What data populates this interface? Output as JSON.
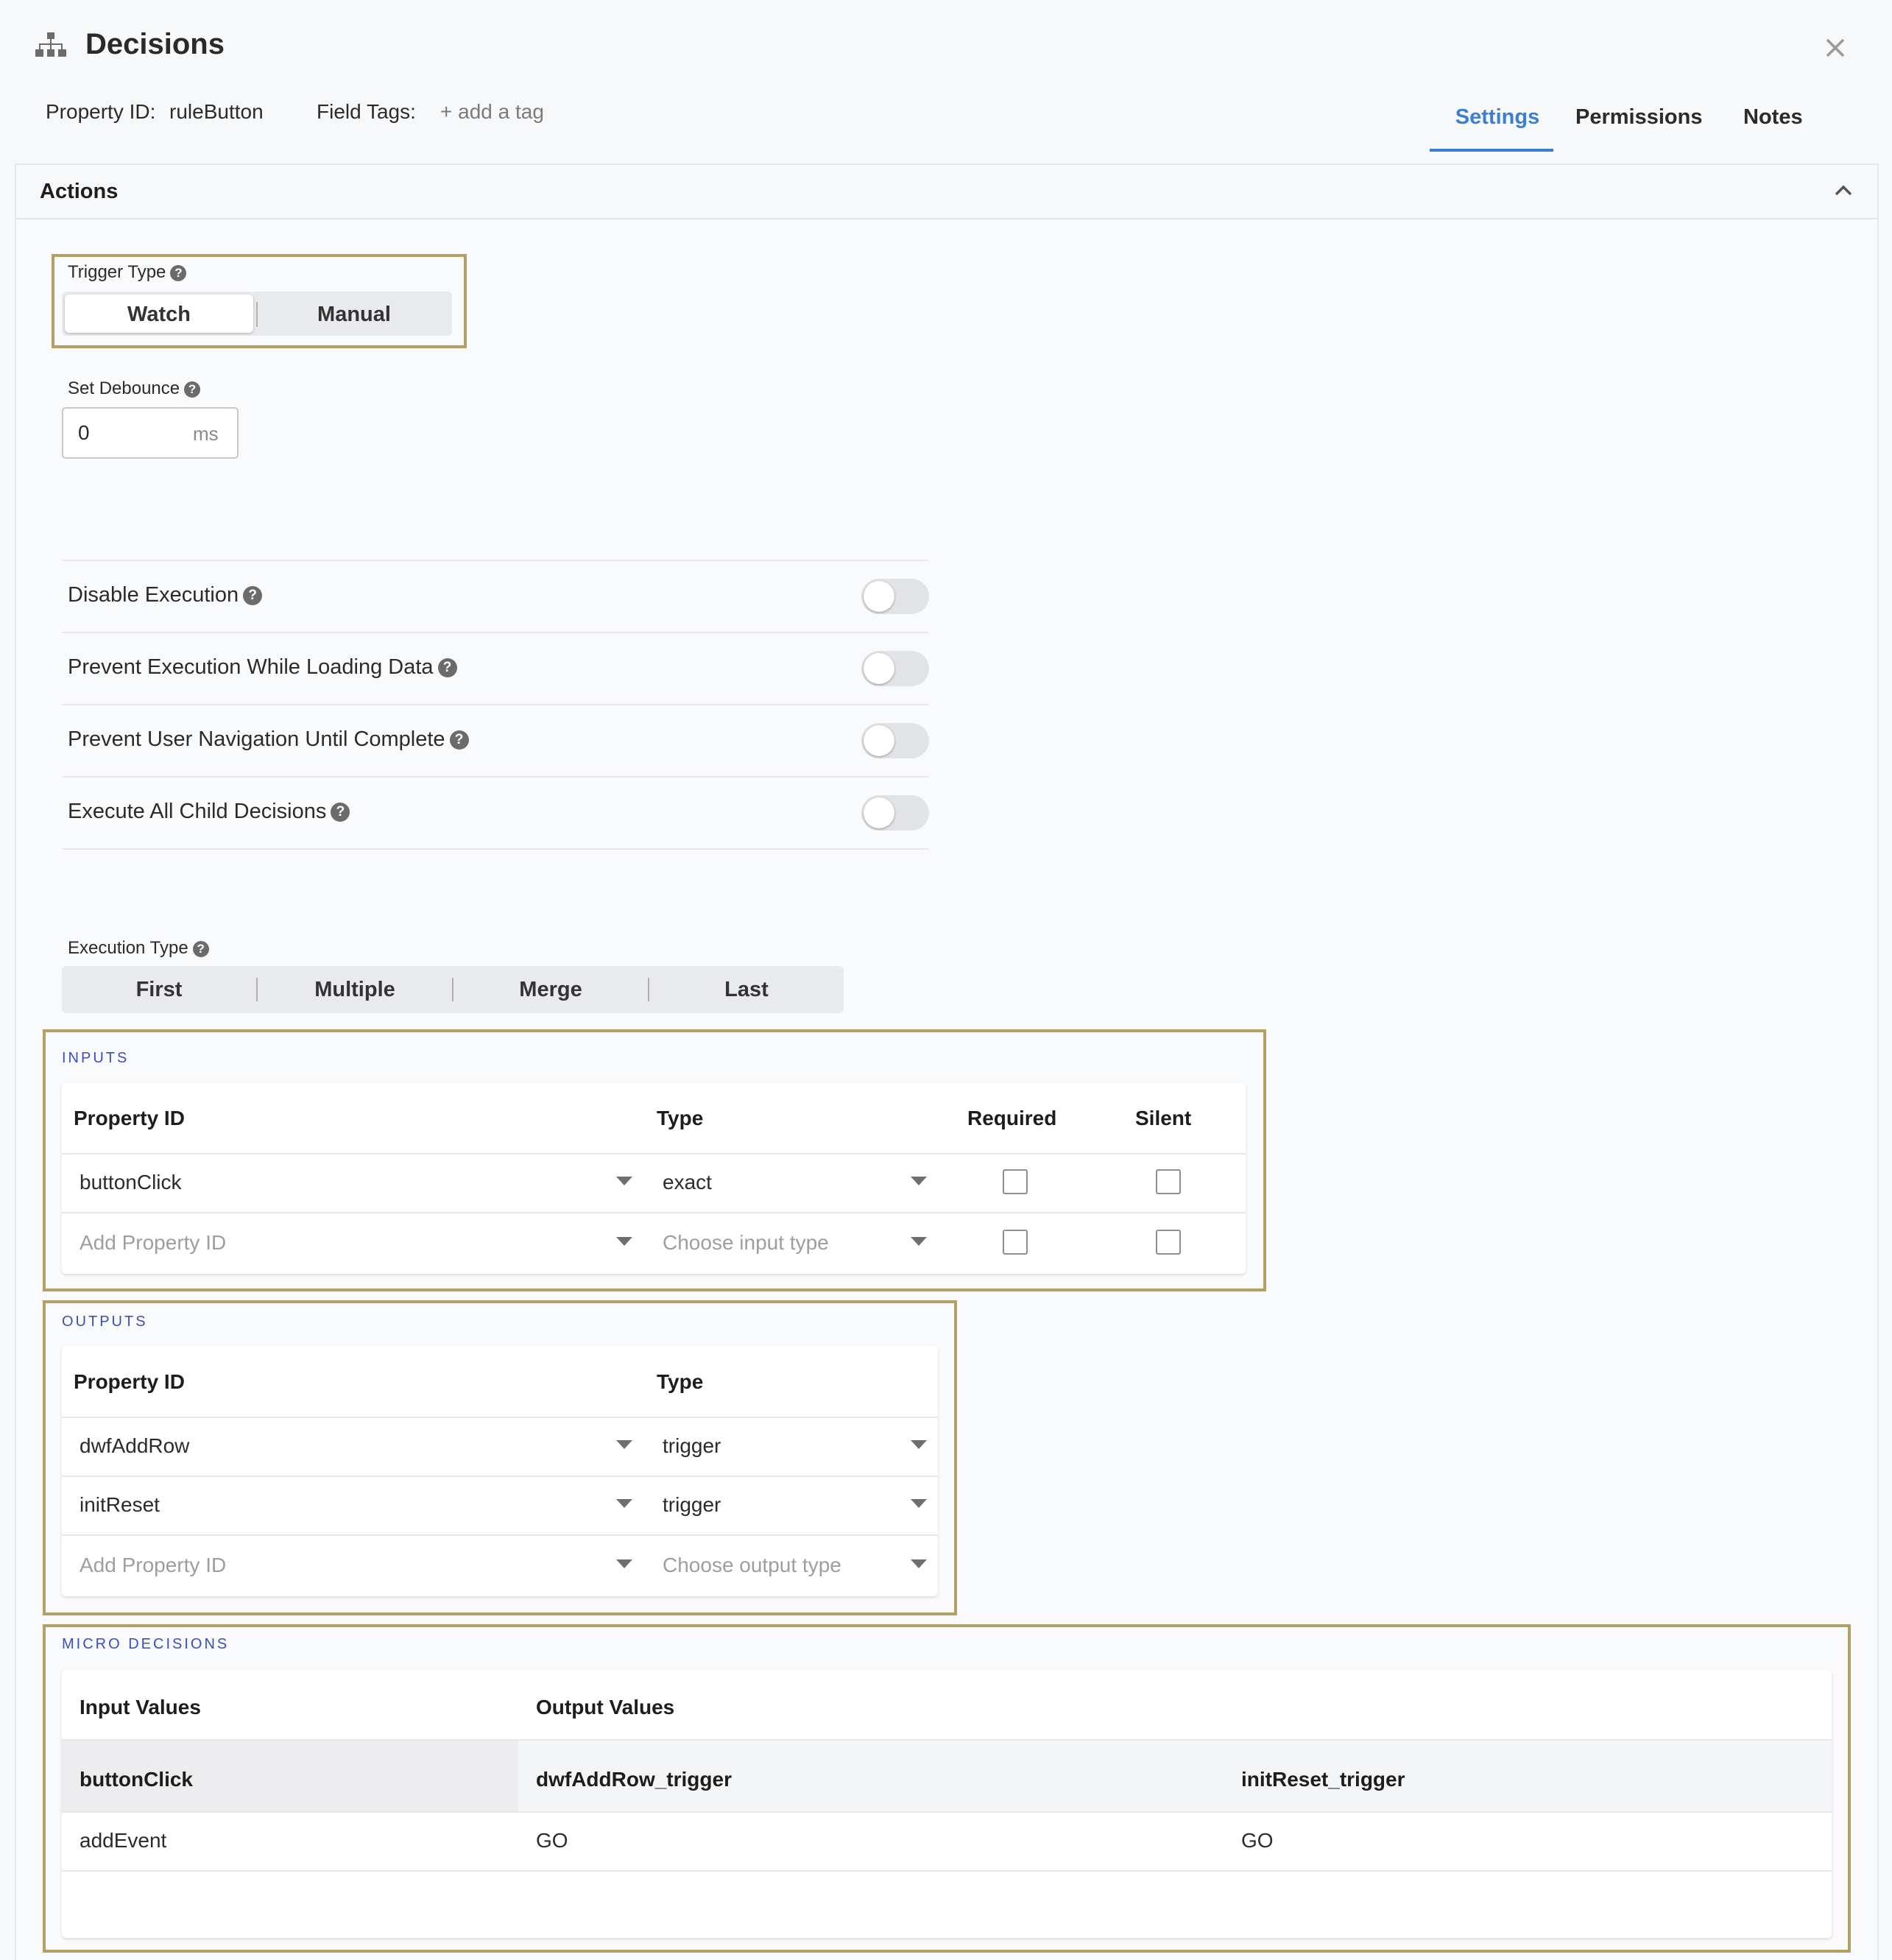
{
  "header": {
    "title": "Decisions",
    "property_id_label": "Property ID:",
    "property_id_value": "ruleButton",
    "field_tags_label": "Field Tags:",
    "add_tag": "+ add a tag",
    "tabs": [
      {
        "label": "Settings",
        "active": true
      },
      {
        "label": "Permissions",
        "active": false
      },
      {
        "label": "Notes",
        "active": false
      }
    ],
    "accent_color": "#3a7fd3"
  },
  "actions": {
    "title": "Actions",
    "trigger_type": {
      "label": "Trigger Type",
      "options": [
        "Watch",
        "Manual"
      ],
      "selected": "Watch"
    },
    "debounce": {
      "label": "Set Debounce",
      "value": "0",
      "unit": "ms"
    },
    "toggles": [
      {
        "label": "Disable Execution",
        "on": false
      },
      {
        "label": "Prevent Execution While Loading Data",
        "on": false
      },
      {
        "label": "Prevent User Navigation Until Complete",
        "on": false
      },
      {
        "label": "Execute All Child Decisions",
        "on": false
      }
    ],
    "execution_type": {
      "label": "Execution Type",
      "options": [
        "First",
        "Multiple",
        "Merge",
        "Last"
      ]
    }
  },
  "inputs": {
    "section": "INPUTS",
    "columns": [
      "Property ID",
      "Type",
      "Required",
      "Silent"
    ],
    "rows": [
      {
        "property_id": "buttonClick",
        "type": "exact",
        "required": false,
        "silent": false
      }
    ],
    "add_property_placeholder": "Add Property ID",
    "type_placeholder": "Choose input type"
  },
  "outputs": {
    "section": "OUTPUTS",
    "columns": [
      "Property ID",
      "Type"
    ],
    "rows": [
      {
        "property_id": "dwfAddRow",
        "type": "trigger"
      },
      {
        "property_id": "initReset",
        "type": "trigger"
      }
    ],
    "add_property_placeholder": "Add Property ID",
    "type_placeholder": "Choose output type"
  },
  "micro": {
    "section": "MICRO DECISIONS",
    "input_values_header": "Input Values",
    "output_values_header": "Output Values",
    "columns": [
      "buttonClick",
      "dwfAddRow_trigger",
      "initReset_trigger"
    ],
    "rows": [
      [
        "addEvent",
        "GO",
        "GO"
      ]
    ]
  },
  "highlight_color": "#b5a063",
  "icons": {
    "header": "sitemap-icon",
    "close": "close-icon",
    "collapse": "chevron-up-icon"
  }
}
